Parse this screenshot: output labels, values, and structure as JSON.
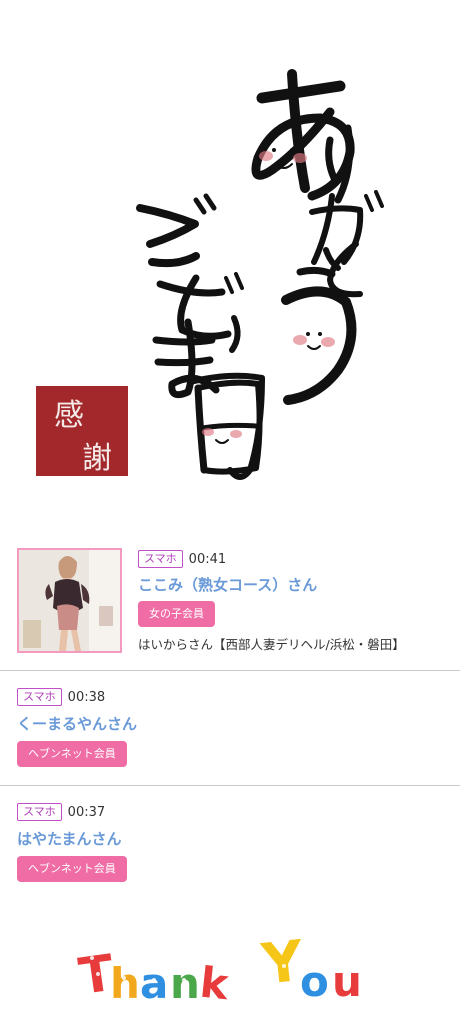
{
  "hero": {
    "image_name": "arigatou-gozaimasu-calligraphy",
    "seal_text": [
      "感",
      "謝"
    ],
    "colors": {
      "ink": "#111111",
      "seal": "#a3282c",
      "cheek": "#e07a85"
    }
  },
  "entries": [
    {
      "device": "スマホ",
      "time": "00:41",
      "name": "ここみ（熟女コース）さん",
      "badge": "女の子会員",
      "shop": "はいからさん【西部人妻デリヘル/浜松・磐田】",
      "has_photo": true
    },
    {
      "device": "スマホ",
      "time": "00:38",
      "name": "くーまるやんさん",
      "badge": "ヘブンネット会員"
    },
    {
      "device": "スマホ",
      "time": "00:37",
      "name": "はやたまんさん",
      "badge": "ヘブンネット会員"
    }
  ],
  "footer": {
    "image_name": "thank-you-colorful-lettering",
    "text": "Thank You"
  },
  "colors": {
    "device_border": "#c14fc8",
    "name": "#6a9ad8",
    "badge_bg": "#f06ca4",
    "photo_border": "#f49ac1"
  }
}
